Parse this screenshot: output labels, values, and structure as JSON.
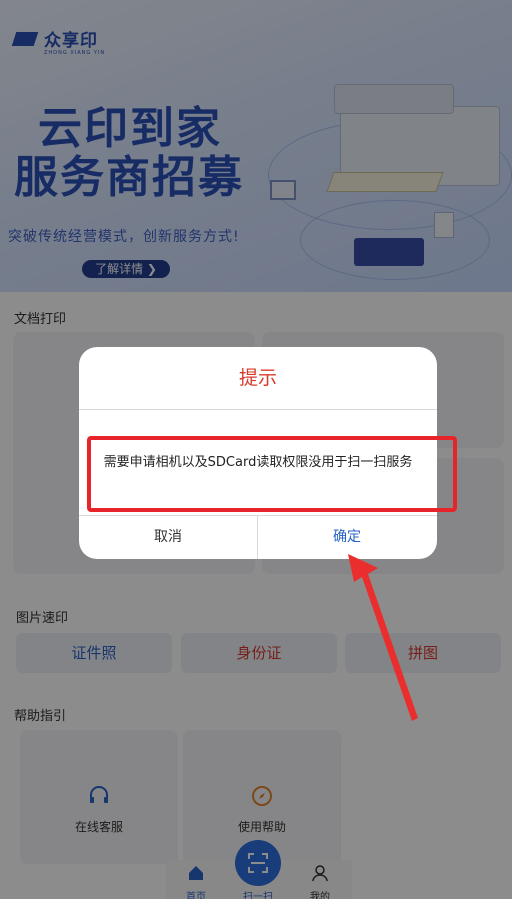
{
  "banner": {
    "logo_text": "众享印",
    "logo_sub": "ZHONG XIANG YIN",
    "headline_line1": "云印到家",
    "headline_line2": "服务商招募",
    "slogan": "突破传统经营模式，创新服务方式!",
    "detail_button": "了解详情 ❯"
  },
  "sections": {
    "doc_print_title": "文档打印",
    "photo_print_title": "图片速印",
    "help_title": "帮助指引"
  },
  "photo_print": {
    "items": [
      {
        "label": "证件照",
        "color": "#2a63c7"
      },
      {
        "label": "身份证",
        "color": "#d73a2c"
      },
      {
        "label": "拼图",
        "color": "#d73a2c"
      }
    ]
  },
  "help": {
    "items": [
      {
        "label": "在线客服",
        "icon": "headset-icon"
      },
      {
        "label": "使用帮助",
        "icon": "compass-icon"
      }
    ]
  },
  "nav": {
    "home": "首页",
    "scan": "扫一扫",
    "mine": "我的"
  },
  "dialog": {
    "title": "提示",
    "message": "需要申请相机以及SDCard读取权限没用于扫一扫服务",
    "cancel": "取消",
    "confirm": "确定"
  },
  "colors": {
    "accent_blue": "#2a63c7",
    "accent_red": "#d73a2c",
    "highlight_red": "#e8242b"
  }
}
